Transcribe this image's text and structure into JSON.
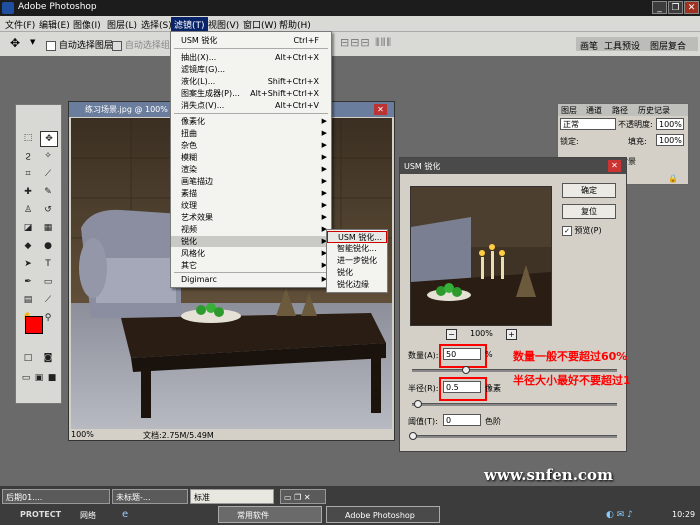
{
  "app": {
    "title": "Adobe Photoshop"
  },
  "menus": [
    "文件(F)",
    "编辑(E)",
    "图像(I)",
    "图层(L)",
    "选择(S)",
    "滤镜(T)",
    "视图(V)",
    "窗口(W)",
    "帮助(H)"
  ],
  "options": {
    "auto_select_layer": "自动选择图层",
    "auto_select_group": "自动选择组",
    "tabs": [
      "画笔",
      "工具预设",
      "图层复合"
    ]
  },
  "filter_menu": {
    "items": [
      {
        "label": "USM 锐化",
        "shortcut": "Ctrl+F"
      },
      {
        "label": "抽出(X)...",
        "shortcut": "Alt+Ctrl+X"
      },
      {
        "label": "滤镜库(G)...",
        "shortcut": ""
      },
      {
        "label": "液化(L)...",
        "shortcut": "Shift+Ctrl+X"
      },
      {
        "label": "图案生成器(P)...",
        "shortcut": "Alt+Shift+Ctrl+X"
      },
      {
        "label": "消失点(V)...",
        "shortcut": "Alt+Ctrl+V"
      }
    ],
    "categories": [
      "像素化",
      "扭曲",
      "杂色",
      "模糊",
      "渲染",
      "画笔描边",
      "素描",
      "纹理",
      "艺术效果",
      "视频",
      "锐化",
      "风格化",
      "其它"
    ],
    "last": "Digimarc"
  },
  "sharpen_submenu": [
    "USM 锐化...",
    "智能锐化...",
    "进一步锐化",
    "锐化",
    "锐化边缘"
  ],
  "document": {
    "title": "练习场景.jpg @ 100% (",
    "zoom": "100%",
    "doc_info": "文档:2.75M/5.49M"
  },
  "layers_panel": {
    "tabs": [
      "图层",
      "通道",
      "路径",
      "历史记录"
    ],
    "blend": "正常",
    "opacity_label": "不透明度:",
    "opacity": "100%",
    "lock_label": "锁定:",
    "fill_label": "填充:",
    "fill": "100%",
    "layer_name": "背景"
  },
  "usm_dialog": {
    "title": "USM 锐化",
    "ok": "确定",
    "reset": "复位",
    "preview": "预览(P)",
    "zoom": "100%",
    "amount_label": "数量(A):",
    "amount_value": "50",
    "amount_unit": "%",
    "radius_label": "半径(R):",
    "radius_value": "0.5",
    "radius_unit": "像素",
    "threshold_label": "阈值(T):",
    "threshold_value": "0",
    "threshold_unit": "色阶"
  },
  "annotations": {
    "amount_tip": "数量一般不要超过60%",
    "radius_tip": "半径大小最好不要超过1"
  },
  "watermark": "www.snfen.com",
  "taskbar": {
    "docs": [
      "后期01....",
      "未标题-..."
    ],
    "ime": "标准",
    "protect": "PROTECT",
    "network": "网络",
    "tasks": [
      "常用软件",
      "Adobe Photoshop"
    ],
    "clock": "10:29"
  },
  "colors": {
    "annotation_red": "#ff0000",
    "menu_highlight": "#0a246a",
    "foreground": "#ff0000",
    "background": "#ffffff"
  }
}
